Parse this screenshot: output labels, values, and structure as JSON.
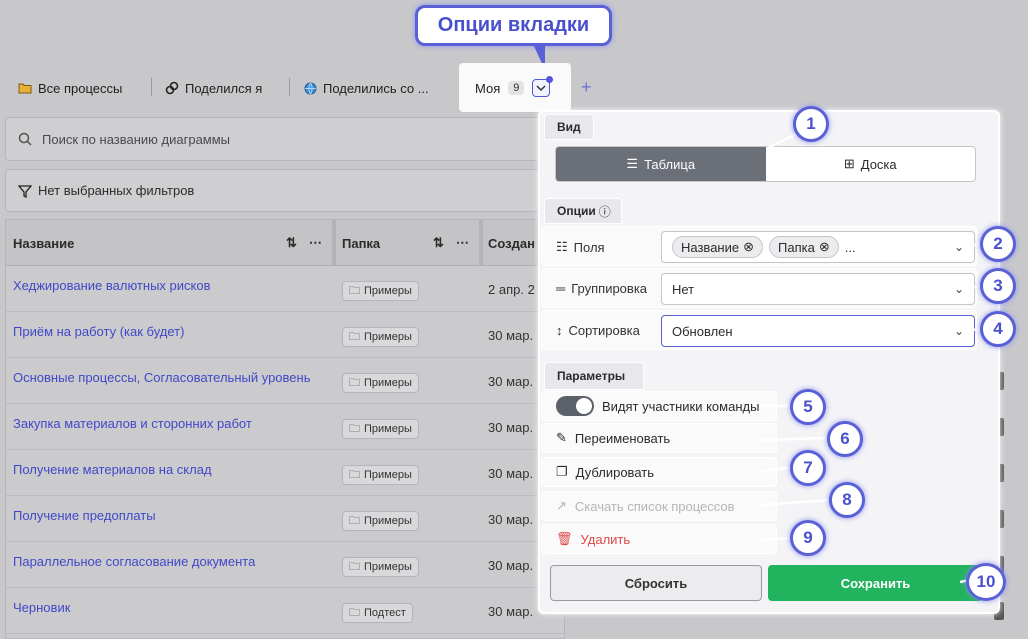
{
  "callout": {
    "label": "Опции вкладки"
  },
  "tabs": [
    {
      "label": "Все процессы",
      "icon": "folder-icon"
    },
    {
      "label": "Поделился я",
      "icon": "link-icon"
    },
    {
      "label": "Поделились со ...",
      "icon": "globe-icon"
    },
    {
      "label": "Моя",
      "badge": "9",
      "icon": "chevron-down-icon"
    }
  ],
  "search": {
    "placeholder": "Поиск по названию диаграммы"
  },
  "filters": {
    "label": "Нет выбранных фильтров"
  },
  "table": {
    "columns": [
      "Название",
      "Папка",
      "Создан"
    ],
    "rows": [
      {
        "name": "Хеджирование валютных рисков",
        "folder": "Примеры",
        "date": "2 апр. 2"
      },
      {
        "name": "Приём на работу (как будет)",
        "folder": "Примеры",
        "date": "30 мар."
      },
      {
        "name": "Основные процессы, Согласовательный уровень",
        "folder": "Примеры",
        "date": "30 мар."
      },
      {
        "name": "Закупка материалов и сторонних работ",
        "folder": "Примеры",
        "date": "30 мар."
      },
      {
        "name": "Получение материалов на склад",
        "folder": "Примеры",
        "date": "30 мар."
      },
      {
        "name": "Получение предоплаты",
        "folder": "Примеры",
        "date": "30 мар."
      },
      {
        "name": "Параллельное согласование документа",
        "folder": "Примеры",
        "date": "30 мар."
      },
      {
        "name": "Черновик",
        "folder": "Подтест",
        "date": "30 мар."
      }
    ]
  },
  "panel": {
    "view_section": "Вид",
    "view_table": "Таблица",
    "view_board": "Доска",
    "options_section": "Опции",
    "fields_label": "Поля",
    "fields_chips": [
      "Название",
      "Папка"
    ],
    "fields_more": "...",
    "group_label": "Группировка",
    "group_value": "Нет",
    "sort_label": "Сортировка",
    "sort_value": "Обновлен",
    "params_section": "Параметры",
    "visible_team": "Видят участники команды",
    "rename": "Переименовать",
    "duplicate": "Дублировать",
    "download": "Скачать список процессов",
    "delete": "Удалить",
    "reset": "Сбросить",
    "save": "Сохранить"
  },
  "markers": [
    "1",
    "2",
    "3",
    "4",
    "5",
    "6",
    "7",
    "8",
    "9",
    "10"
  ],
  "colors": {
    "accent": "#5a61d6",
    "save": "#22b35e",
    "danger": "#e04848"
  }
}
